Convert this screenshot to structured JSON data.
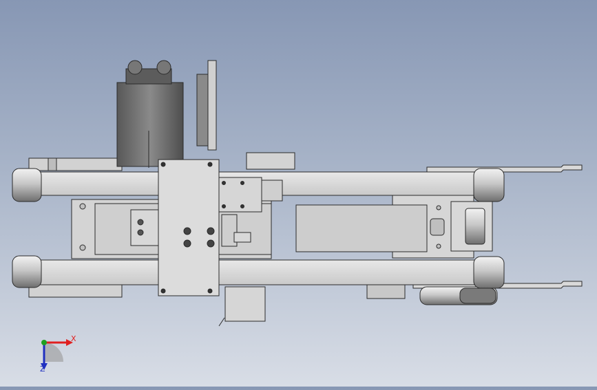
{
  "viewport": {
    "description_free": true,
    "background_top": "#8797b4",
    "background_bottom": "#d8dde6"
  },
  "model": {
    "part_fill": "#d9d9d9",
    "part_edge": "#2a2a2a",
    "shade_fill": "#9a9a9a",
    "motor_fill": "#6e6e6e"
  },
  "triad": {
    "x_label": "X",
    "z_label": "Z",
    "x_color": "#e02020",
    "y_color": "#1fa01f",
    "z_color": "#2030c0"
  }
}
